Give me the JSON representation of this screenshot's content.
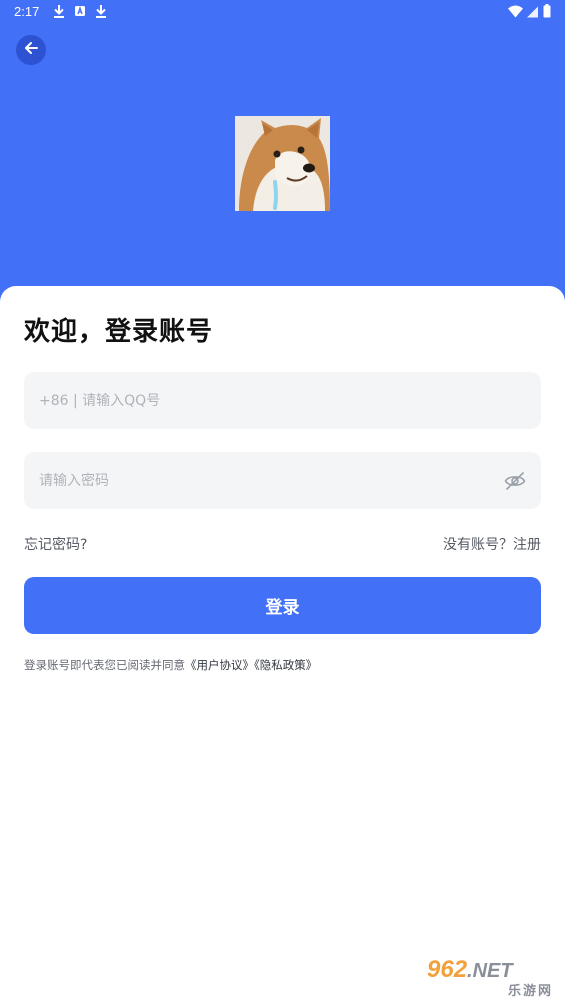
{
  "status_bar": {
    "time": "2:17",
    "left_icons": [
      "download-icon",
      "app-store-icon",
      "download-icon"
    ],
    "right_icons": [
      "wifi-icon",
      "signal-icon",
      "battery-icon"
    ]
  },
  "header": {
    "background_color": "#4270f7",
    "back_icon": "arrow-left-icon",
    "avatar": "shiba-dog-avatar"
  },
  "login": {
    "title": "欢迎，登录账号",
    "phone_placeholder": "+86 | 请输入QQ号",
    "phone_value": "",
    "password_placeholder": "请输入密码",
    "password_value": "",
    "password_toggle_icon": "eye-off-icon",
    "forgot_password": "忘记密码?",
    "register": "没有账号？注册",
    "login_button": "登录",
    "agreement_prefix": "登录账号即代表您已阅读并同意",
    "user_agreement": "《用户协议》",
    "privacy_policy": "《隐私政策》",
    "accent_color": "#4270f7"
  },
  "watermark": {
    "top": "962",
    "top_suffix": ".NET",
    "bottom": "乐游网"
  }
}
